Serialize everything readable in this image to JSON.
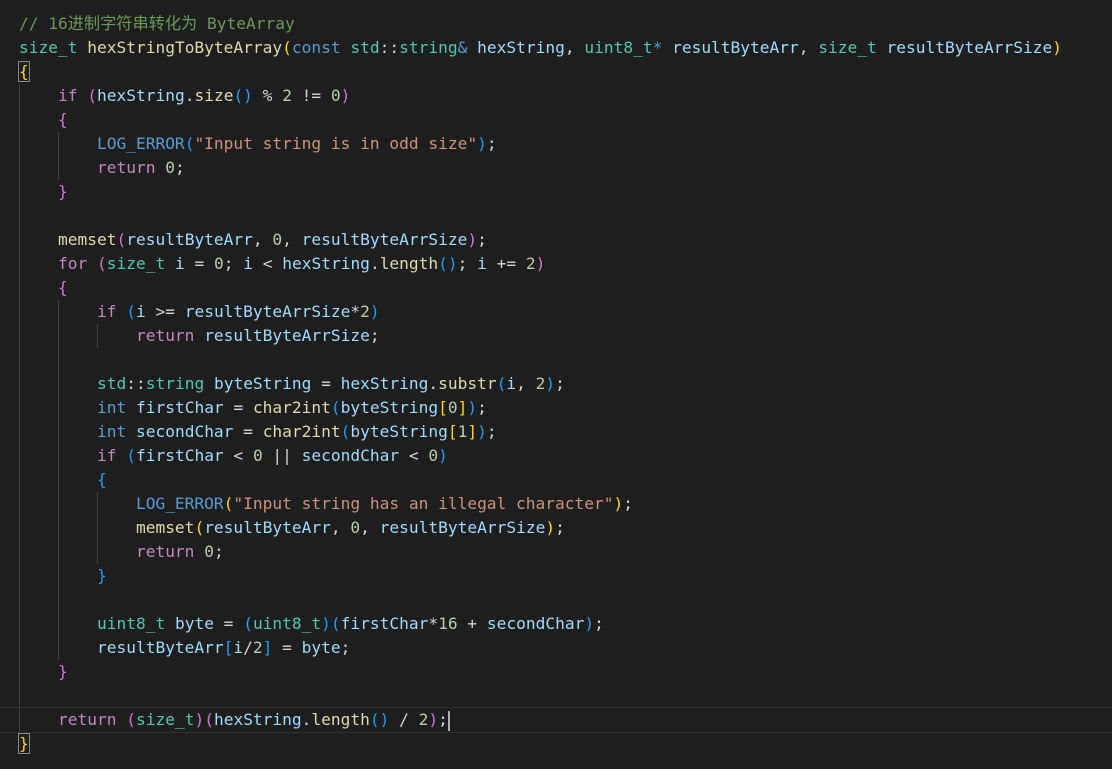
{
  "editor": {
    "colors": {
      "background": "#1e1e1e",
      "comment": "#6a9955",
      "type": "#4ec9b0",
      "function": "#dcdcaa",
      "keyword": "#569cd6",
      "control": "#c586c0",
      "variable": "#9cdcfe",
      "string": "#ce9178",
      "number": "#b5cea8",
      "bracket_1": "#ffd700",
      "bracket_2": "#da70d6",
      "bracket_3": "#179fff"
    },
    "lines": [
      {
        "guides": 0,
        "tokens": [
          [
            "comment",
            "// 16进制字符串转化为 ByteArray"
          ]
        ]
      },
      {
        "guides": 0,
        "tokens": [
          [
            "type",
            "size_t"
          ],
          [
            "plain",
            " "
          ],
          [
            "func",
            "hexStringToByteArray"
          ],
          [
            "b1",
            "("
          ],
          [
            "kw",
            "const"
          ],
          [
            "plain",
            " "
          ],
          [
            "type",
            "std"
          ],
          [
            "plain",
            "::"
          ],
          [
            "type",
            "string"
          ],
          [
            "kw",
            "&"
          ],
          [
            "plain",
            " "
          ],
          [
            "var",
            "hexString"
          ],
          [
            "plain",
            ", "
          ],
          [
            "type",
            "uint8_t"
          ],
          [
            "kw",
            "*"
          ],
          [
            "plain",
            " "
          ],
          [
            "var",
            "resultByteArr"
          ],
          [
            "plain",
            ", "
          ],
          [
            "type",
            "size_t"
          ],
          [
            "plain",
            " "
          ],
          [
            "var",
            "resultByteArrSize"
          ],
          [
            "b1",
            ")"
          ]
        ]
      },
      {
        "guides": 0,
        "tokens": [
          [
            "b1m",
            "{"
          ]
        ]
      },
      {
        "guides": 1,
        "tokens": [
          [
            "plain",
            "    "
          ],
          [
            "ctrl",
            "if"
          ],
          [
            "plain",
            " "
          ],
          [
            "b2",
            "("
          ],
          [
            "var",
            "hexString"
          ],
          [
            "plain",
            "."
          ],
          [
            "func",
            "size"
          ],
          [
            "b3",
            "()"
          ],
          [
            "plain",
            " % "
          ],
          [
            "num",
            "2"
          ],
          [
            "plain",
            " != "
          ],
          [
            "num",
            "0"
          ],
          [
            "b2",
            ")"
          ]
        ]
      },
      {
        "guides": 1,
        "tokens": [
          [
            "plain",
            "    "
          ],
          [
            "b2",
            "{"
          ]
        ]
      },
      {
        "guides": 2,
        "tokens": [
          [
            "plain",
            "        "
          ],
          [
            "macro",
            "LOG_ERROR"
          ],
          [
            "b3",
            "("
          ],
          [
            "str",
            "\"Input string is in odd size\""
          ],
          [
            "b3",
            ")"
          ],
          [
            "plain",
            ";"
          ]
        ]
      },
      {
        "guides": 2,
        "tokens": [
          [
            "plain",
            "        "
          ],
          [
            "ctrl",
            "return"
          ],
          [
            "plain",
            " "
          ],
          [
            "num",
            "0"
          ],
          [
            "plain",
            ";"
          ]
        ]
      },
      {
        "guides": 1,
        "tokens": [
          [
            "plain",
            "    "
          ],
          [
            "b2",
            "}"
          ]
        ]
      },
      {
        "guides": 1,
        "tokens": [
          [
            "plain",
            ""
          ]
        ]
      },
      {
        "guides": 1,
        "tokens": [
          [
            "plain",
            "    "
          ],
          [
            "func",
            "memset"
          ],
          [
            "b2",
            "("
          ],
          [
            "var",
            "resultByteArr"
          ],
          [
            "plain",
            ", "
          ],
          [
            "num",
            "0"
          ],
          [
            "plain",
            ", "
          ],
          [
            "var",
            "resultByteArrSize"
          ],
          [
            "b2",
            ")"
          ],
          [
            "plain",
            ";"
          ]
        ]
      },
      {
        "guides": 1,
        "tokens": [
          [
            "plain",
            "    "
          ],
          [
            "ctrl",
            "for"
          ],
          [
            "plain",
            " "
          ],
          [
            "b2",
            "("
          ],
          [
            "type",
            "size_t"
          ],
          [
            "plain",
            " "
          ],
          [
            "var",
            "i"
          ],
          [
            "plain",
            " = "
          ],
          [
            "num",
            "0"
          ],
          [
            "plain",
            "; "
          ],
          [
            "var",
            "i"
          ],
          [
            "plain",
            " < "
          ],
          [
            "var",
            "hexString"
          ],
          [
            "plain",
            "."
          ],
          [
            "func",
            "length"
          ],
          [
            "b3",
            "()"
          ],
          [
            "plain",
            "; "
          ],
          [
            "var",
            "i"
          ],
          [
            "plain",
            " += "
          ],
          [
            "num",
            "2"
          ],
          [
            "b2",
            ")"
          ]
        ]
      },
      {
        "guides": 1,
        "tokens": [
          [
            "plain",
            "    "
          ],
          [
            "b2",
            "{"
          ]
        ]
      },
      {
        "guides": 2,
        "tokens": [
          [
            "plain",
            "        "
          ],
          [
            "ctrl",
            "if"
          ],
          [
            "plain",
            " "
          ],
          [
            "b3",
            "("
          ],
          [
            "var",
            "i"
          ],
          [
            "plain",
            " >= "
          ],
          [
            "var",
            "resultByteArrSize"
          ],
          [
            "plain",
            "*"
          ],
          [
            "num",
            "2"
          ],
          [
            "b3",
            ")"
          ]
        ]
      },
      {
        "guides": 3,
        "tokens": [
          [
            "plain",
            "            "
          ],
          [
            "ctrl",
            "return"
          ],
          [
            "plain",
            " "
          ],
          [
            "var",
            "resultByteArrSize"
          ],
          [
            "plain",
            ";"
          ]
        ]
      },
      {
        "guides": 2,
        "tokens": [
          [
            "plain",
            ""
          ]
        ]
      },
      {
        "guides": 2,
        "tokens": [
          [
            "plain",
            "        "
          ],
          [
            "type",
            "std"
          ],
          [
            "plain",
            "::"
          ],
          [
            "type",
            "string"
          ],
          [
            "plain",
            " "
          ],
          [
            "var",
            "byteString"
          ],
          [
            "plain",
            " = "
          ],
          [
            "var",
            "hexString"
          ],
          [
            "plain",
            "."
          ],
          [
            "func",
            "substr"
          ],
          [
            "b3",
            "("
          ],
          [
            "var",
            "i"
          ],
          [
            "plain",
            ", "
          ],
          [
            "num",
            "2"
          ],
          [
            "b3",
            ")"
          ],
          [
            "plain",
            ";"
          ]
        ]
      },
      {
        "guides": 2,
        "tokens": [
          [
            "plain",
            "        "
          ],
          [
            "kw",
            "int"
          ],
          [
            "plain",
            " "
          ],
          [
            "var",
            "firstChar"
          ],
          [
            "plain",
            " = "
          ],
          [
            "func",
            "char2int"
          ],
          [
            "b3",
            "("
          ],
          [
            "var",
            "byteString"
          ],
          [
            "b1",
            "["
          ],
          [
            "num",
            "0"
          ],
          [
            "b1",
            "]"
          ],
          [
            "b3",
            ")"
          ],
          [
            "plain",
            ";"
          ]
        ]
      },
      {
        "guides": 2,
        "tokens": [
          [
            "plain",
            "        "
          ],
          [
            "kw",
            "int"
          ],
          [
            "plain",
            " "
          ],
          [
            "var",
            "secondChar"
          ],
          [
            "plain",
            " = "
          ],
          [
            "func",
            "char2int"
          ],
          [
            "b3",
            "("
          ],
          [
            "var",
            "byteString"
          ],
          [
            "b1",
            "["
          ],
          [
            "num",
            "1"
          ],
          [
            "b1",
            "]"
          ],
          [
            "b3",
            ")"
          ],
          [
            "plain",
            ";"
          ]
        ]
      },
      {
        "guides": 2,
        "tokens": [
          [
            "plain",
            "        "
          ],
          [
            "ctrl",
            "if"
          ],
          [
            "plain",
            " "
          ],
          [
            "b3",
            "("
          ],
          [
            "var",
            "firstChar"
          ],
          [
            "plain",
            " < "
          ],
          [
            "num",
            "0"
          ],
          [
            "plain",
            " || "
          ],
          [
            "var",
            "secondChar"
          ],
          [
            "plain",
            " < "
          ],
          [
            "num",
            "0"
          ],
          [
            "b3",
            ")"
          ]
        ]
      },
      {
        "guides": 2,
        "tokens": [
          [
            "plain",
            "        "
          ],
          [
            "b3",
            "{"
          ]
        ]
      },
      {
        "guides": 3,
        "tokens": [
          [
            "plain",
            "            "
          ],
          [
            "macro",
            "LOG_ERROR"
          ],
          [
            "b1",
            "("
          ],
          [
            "str",
            "\"Input string has an illegal character\""
          ],
          [
            "b1",
            ")"
          ],
          [
            "plain",
            ";"
          ]
        ]
      },
      {
        "guides": 3,
        "tokens": [
          [
            "plain",
            "            "
          ],
          [
            "func",
            "memset"
          ],
          [
            "b1",
            "("
          ],
          [
            "var",
            "resultByteArr"
          ],
          [
            "plain",
            ", "
          ],
          [
            "num",
            "0"
          ],
          [
            "plain",
            ", "
          ],
          [
            "var",
            "resultByteArrSize"
          ],
          [
            "b1",
            ")"
          ],
          [
            "plain",
            ";"
          ]
        ]
      },
      {
        "guides": 3,
        "tokens": [
          [
            "plain",
            "            "
          ],
          [
            "ctrl",
            "return"
          ],
          [
            "plain",
            " "
          ],
          [
            "num",
            "0"
          ],
          [
            "plain",
            ";"
          ]
        ]
      },
      {
        "guides": 2,
        "tokens": [
          [
            "plain",
            "        "
          ],
          [
            "b3",
            "}"
          ]
        ]
      },
      {
        "guides": 2,
        "tokens": [
          [
            "plain",
            ""
          ]
        ]
      },
      {
        "guides": 2,
        "tokens": [
          [
            "plain",
            "        "
          ],
          [
            "type",
            "uint8_t"
          ],
          [
            "plain",
            " "
          ],
          [
            "var",
            "byte"
          ],
          [
            "plain",
            " = "
          ],
          [
            "b3",
            "("
          ],
          [
            "type",
            "uint8_t"
          ],
          [
            "b3",
            ")"
          ],
          [
            "b3",
            "("
          ],
          [
            "var",
            "firstChar"
          ],
          [
            "plain",
            "*"
          ],
          [
            "num",
            "16"
          ],
          [
            "plain",
            " + "
          ],
          [
            "var",
            "secondChar"
          ],
          [
            "b3",
            ")"
          ],
          [
            "plain",
            ";"
          ]
        ]
      },
      {
        "guides": 2,
        "tokens": [
          [
            "plain",
            "        "
          ],
          [
            "var",
            "resultByteArr"
          ],
          [
            "b3",
            "["
          ],
          [
            "var",
            "i"
          ],
          [
            "plain",
            "/"
          ],
          [
            "num",
            "2"
          ],
          [
            "b3",
            "]"
          ],
          [
            "plain",
            " = "
          ],
          [
            "var",
            "byte"
          ],
          [
            "plain",
            ";"
          ]
        ]
      },
      {
        "guides": 1,
        "tokens": [
          [
            "plain",
            "    "
          ],
          [
            "b2",
            "}"
          ]
        ]
      },
      {
        "guides": 1,
        "tokens": [
          [
            "plain",
            ""
          ]
        ]
      },
      {
        "guides": 1,
        "current": true,
        "tokens": [
          [
            "plain",
            "    "
          ],
          [
            "ctrl",
            "return"
          ],
          [
            "plain",
            " "
          ],
          [
            "b2",
            "("
          ],
          [
            "type",
            "size_t"
          ],
          [
            "b2",
            ")"
          ],
          [
            "b2",
            "("
          ],
          [
            "var",
            "hexString"
          ],
          [
            "plain",
            "."
          ],
          [
            "func",
            "length"
          ],
          [
            "b3",
            "()"
          ],
          [
            "plain",
            " / "
          ],
          [
            "num",
            "2"
          ],
          [
            "b2",
            ")"
          ],
          [
            "plain",
            ";"
          ],
          [
            "cursor",
            ""
          ]
        ]
      },
      {
        "guides": 0,
        "tokens": [
          [
            "b1m",
            "}"
          ]
        ]
      }
    ]
  }
}
